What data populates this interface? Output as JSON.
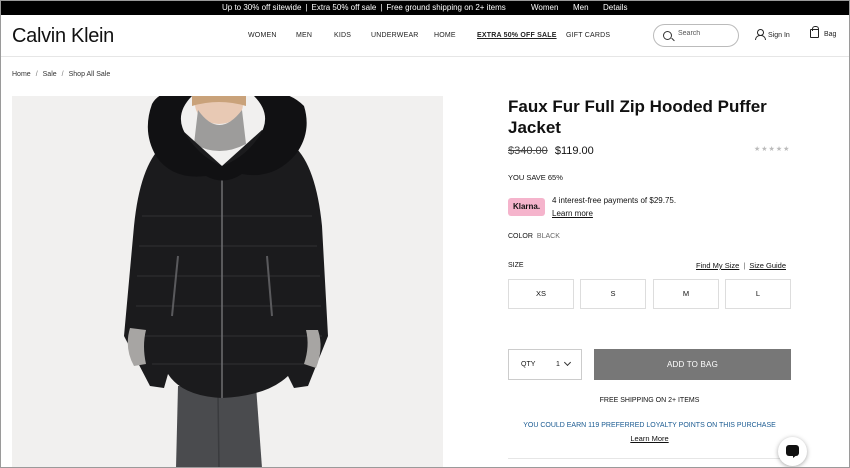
{
  "promo_bar": {
    "messages": [
      "Up to 30% off sitewide",
      "Extra 50% off sale",
      "Free ground shipping on 2+ items"
    ],
    "separator": "|",
    "links": [
      "Women",
      "Men",
      "Details"
    ]
  },
  "header": {
    "logo": "Calvin Klein",
    "nav": [
      "WOMEN",
      "MEN",
      "KIDS",
      "UNDERWEAR",
      "HOME",
      "EXTRA 50% OFF SALE",
      "GIFT CARDS"
    ],
    "search_placeholder": "Search",
    "sign_in": "Sign In",
    "bag": "Bag"
  },
  "breadcrumb": {
    "items": [
      "Home",
      "Sale",
      "Shop All Sale"
    ],
    "separator": "/"
  },
  "product": {
    "title": "Faux Fur Full Zip Hooded Puffer Jacket",
    "original_price": "$340.00",
    "sale_price": "$119.00",
    "rating_stars": "★★★★★",
    "you_save": "YOU SAVE 65%",
    "klarna": {
      "badge": "Klarna.",
      "text": "4 interest-free payments of $29.75.",
      "link": "Learn more"
    },
    "color_label": "COLOR",
    "color_value": "BLACK",
    "size_label": "SIZE",
    "find_my_size": "Find My Size",
    "size_divider": "|",
    "size_guide": "Size Guide",
    "sizes": [
      "XS",
      "S",
      "M",
      "L"
    ],
    "qty_label": "QTY",
    "qty_value": "1",
    "add_to_bag": "ADD TO BAG",
    "free_shipping": "FREE SHIPPING ON 2+ ITEMS",
    "loyalty": "YOU COULD EARN 119 PREFERRED LOYALTY POINTS ON THIS PURCHASE",
    "loyalty_link": "Learn More"
  },
  "icons": {
    "search": "search-icon",
    "account": "person-icon",
    "bag": "bag-icon",
    "chat": "chat-icon",
    "qty_dropdown": "chevron-down-icon"
  },
  "colors": {
    "promo_bar": "#000000",
    "add_to_bag": "#777777",
    "klarna_badge": "#f5b4cc",
    "loyalty_text": "#1a5a91"
  }
}
